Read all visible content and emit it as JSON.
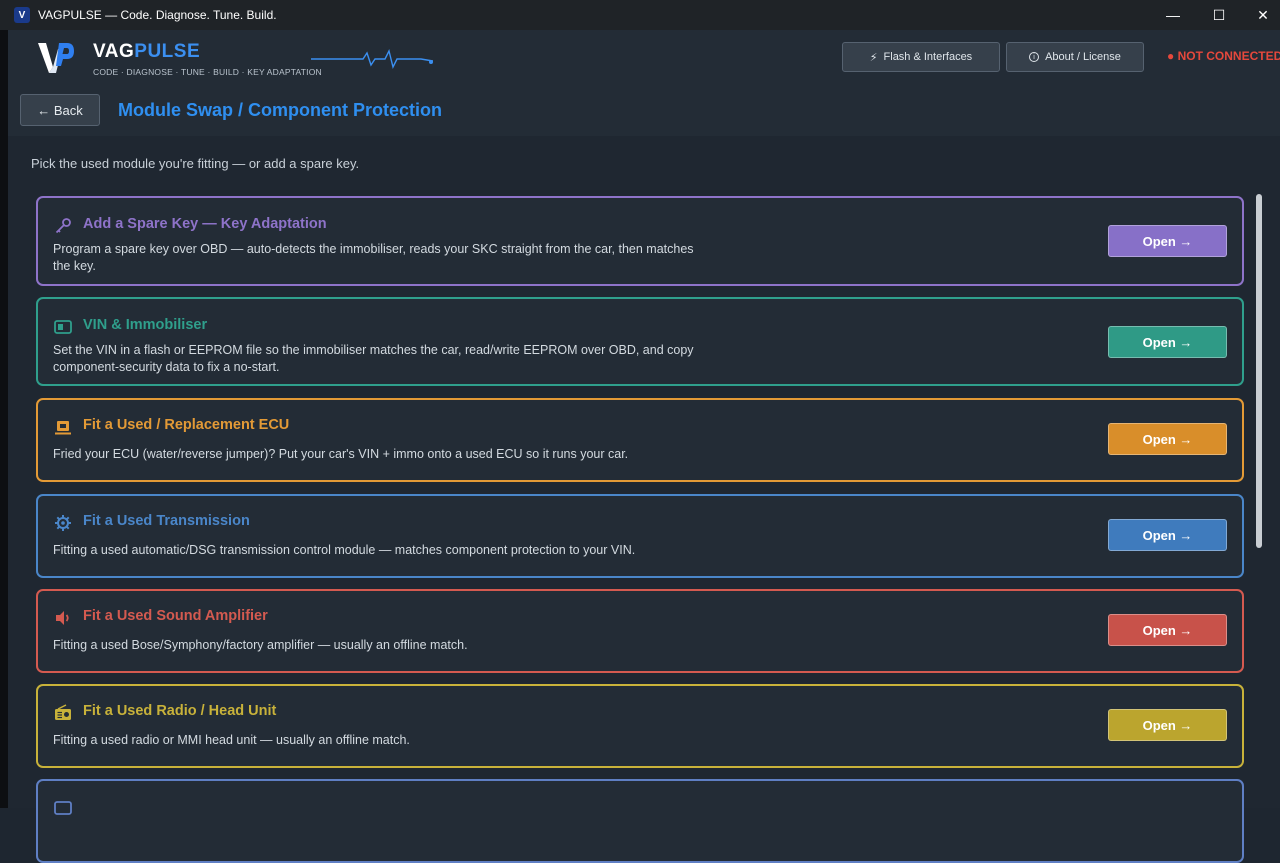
{
  "window": {
    "title": "VAGPULSE — Code. Diagnose. Tune. Build.",
    "app_icon_letter": "V",
    "minimize": "—",
    "maximize": "☐",
    "close": "✕"
  },
  "header": {
    "brand_part1": "VAG",
    "brand_part2": "PULSE",
    "tagline": "CODE · DIAGNOSE · TUNE · BUILD · KEY ADAPTATION",
    "flash_button": "Flash & Interfaces",
    "about_button": "About / License",
    "connection_status": "● NOT CONNECTED",
    "back_button": "← Back",
    "page_title": "Module Swap / Component Protection"
  },
  "intro": "Pick the used module you're fitting — or add a spare key.",
  "cards": [
    {
      "title": "Add a Spare Key — Key Adaptation",
      "description": "Program a spare key over OBD — auto-detects the immobiliser, reads your SKC straight from the car, then matches the key.",
      "icon": "key-icon",
      "accent": "#8e73c9",
      "button": "#8770c8",
      "open_label": "Open →"
    },
    {
      "title": "VIN & Immobiliser",
      "description": "Set the VIN in a flash or EEPROM file so the immobiliser matches the car, read/write EEPROM over OBD, and copy component-security data to fix a no-start.",
      "icon": "id-card-icon",
      "accent": "#2f9f8c",
      "button": "#2f9a86",
      "open_label": "Open →"
    },
    {
      "title": "Fit a Used / Replacement ECU",
      "description": "Fried your ECU (water/reverse jumper)? Put your car's VIN + immo onto a used ECU so it runs your car.",
      "icon": "chip-icon",
      "accent": "#e39a36",
      "button": "#d98e2a",
      "open_label": "Open →"
    },
    {
      "title": "Fit a Used Transmission",
      "description": "Fitting a used automatic/DSG transmission control module — matches component protection to your VIN.",
      "icon": "gear-icon",
      "accent": "#4a86c9",
      "button": "#3f7bbd",
      "open_label": "Open →"
    },
    {
      "title": "Fit a Used Sound Amplifier",
      "description": "Fitting a used Bose/Symphony/factory amplifier — usually an offline match.",
      "icon": "speaker-icon",
      "accent": "#d45a50",
      "button": "#c8524a",
      "open_label": "Open →"
    },
    {
      "title": "Fit a Used Radio / Head Unit",
      "description": "Fitting a used radio or MMI head unit — usually an offline match.",
      "icon": "radio-icon",
      "accent": "#c8b23a",
      "button": "#bba52e",
      "open_label": "Open →"
    },
    {
      "title": "",
      "description": "",
      "icon": "dashboard-icon",
      "accent": "#5f7fc4",
      "button": "#5a78ba",
      "open_label": ""
    }
  ]
}
